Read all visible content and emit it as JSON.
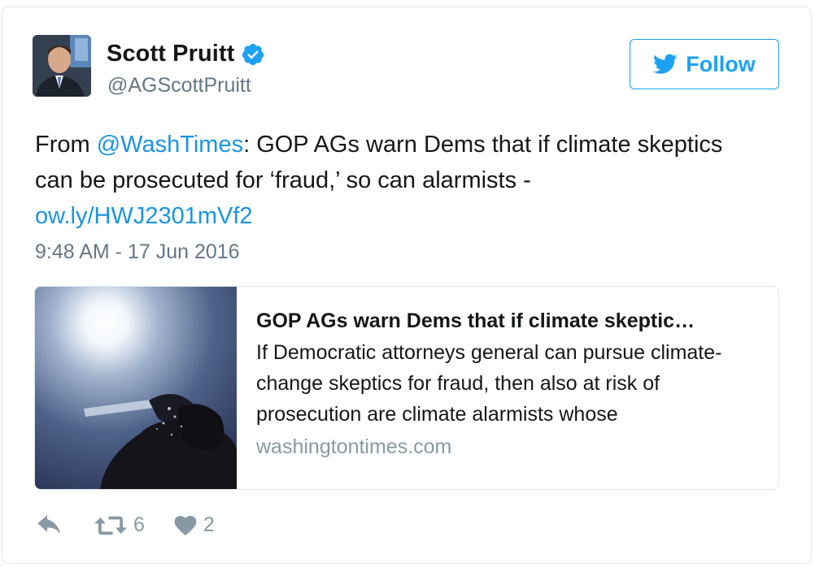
{
  "author": {
    "display_name": "Scott Pruitt",
    "handle": "@AGScottPruitt",
    "verified_icon": "verified-badge-icon"
  },
  "follow_button": {
    "label": "Follow",
    "icon": "twitter-bird-icon"
  },
  "tweet": {
    "prefix": "From ",
    "mention": "@WashTimes",
    "body": ": GOP AGs warn Dems that if climate skeptics can be prosecuted for ‘fraud,’ so can alarmists - ",
    "link": "ow.ly/HWJ2301mVf2",
    "timestamp": "9:48 AM - 17 Jun 2016"
  },
  "link_card": {
    "title": "GOP AGs warn Dems that if climate skeptic…",
    "description": "If Democratic attorneys general can pursue climate-change skeptics for fraud, then also at risk of prosecution are climate alarmists whose",
    "domain": "washingtontimes.com"
  },
  "actions": {
    "reply_icon": "reply-icon",
    "retweet_icon": "retweet-icon",
    "retweet_count": "6",
    "like_icon": "heart-icon",
    "like_count": "2"
  },
  "colors": {
    "accent": "#1da1f2",
    "link": "#1b95e0",
    "muted": "#657786",
    "border": "#e1e8ed"
  }
}
